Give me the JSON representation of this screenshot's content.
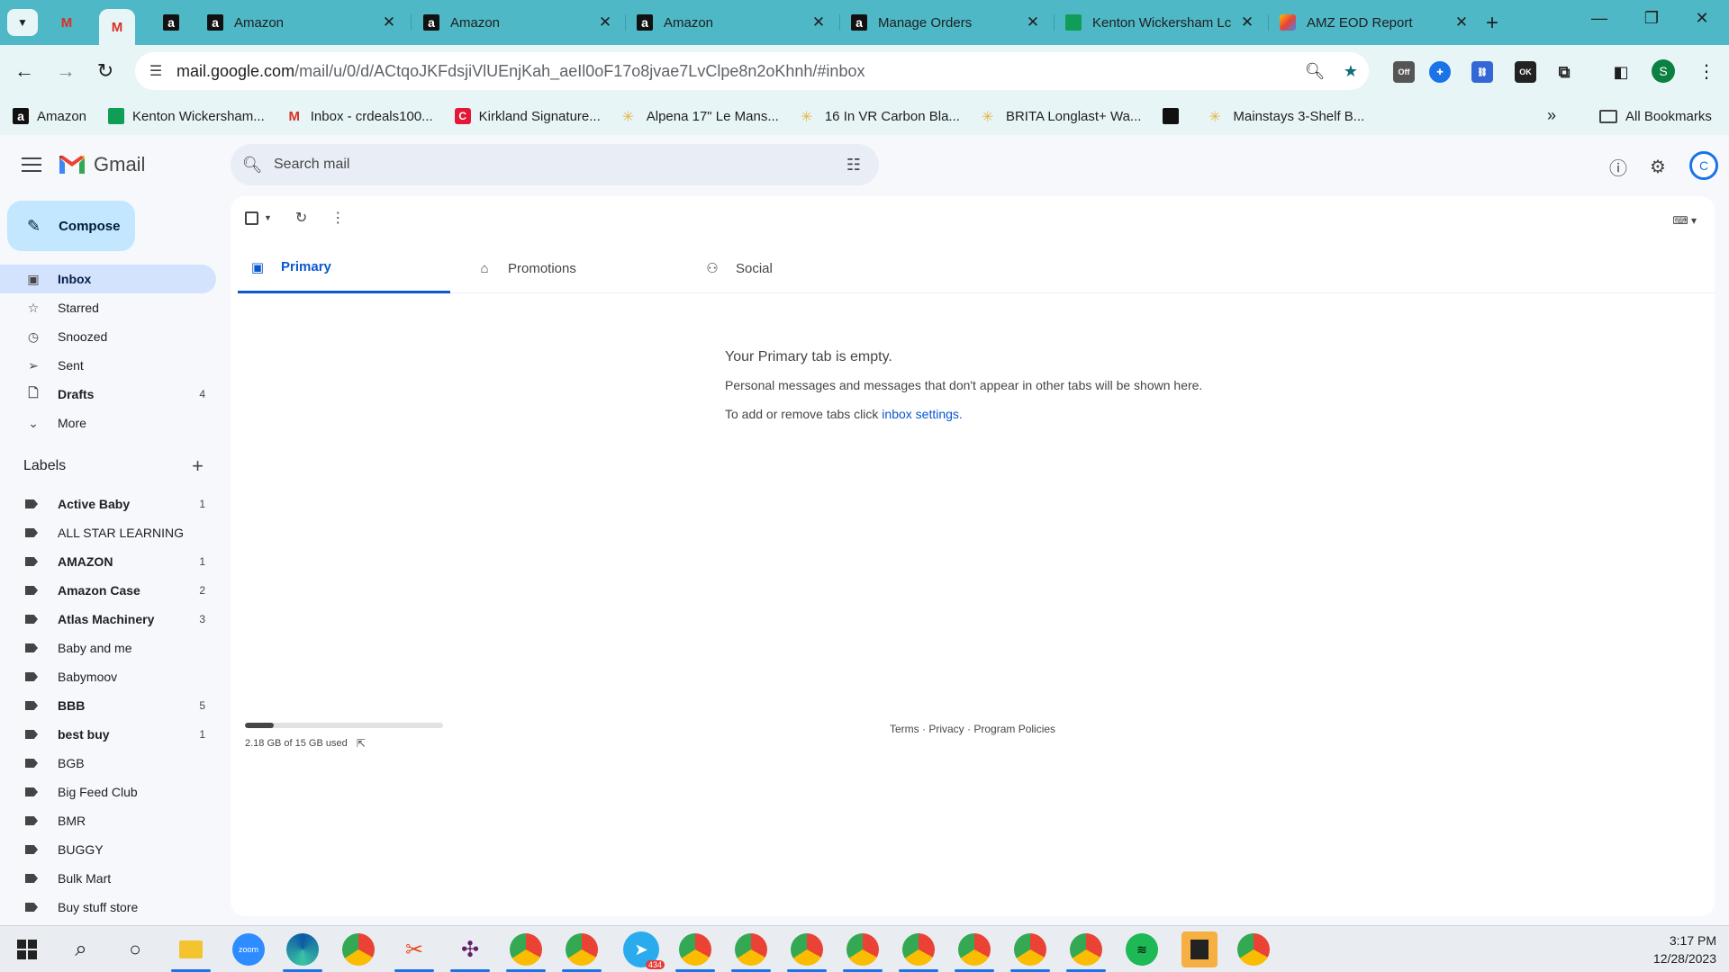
{
  "browser": {
    "tabs": [
      {
        "title": "Amazon"
      },
      {
        "title": "Amazon"
      },
      {
        "title": "Amazon"
      },
      {
        "title": "Manage Orders"
      },
      {
        "title": "Kenton Wickersham Lc"
      },
      {
        "title": "AMZ EOD Report"
      }
    ],
    "url_host": "mail.google.com",
    "url_path": "/mail/u/0/d/ACtqoJKFdsjiVlUEnjKah_aeIl0oF17o8jvae7LvClpe8n2oKhnh/#inbox",
    "profile_initial": "S",
    "ext_off_label": "Off",
    "ext_ok_label": "OK"
  },
  "bookmarks": [
    {
      "label": "Amazon",
      "icon": "amazon"
    },
    {
      "label": "Kenton Wickersham...",
      "icon": "sheets"
    },
    {
      "label": "Inbox - crdeals100...",
      "icon": "gmail"
    },
    {
      "label": "Kirkland Signature...",
      "icon": "costco"
    },
    {
      "label": "Alpena 17\" Le Mans...",
      "icon": "walmart"
    },
    {
      "label": "16 In VR Carbon Bla...",
      "icon": "walmart"
    },
    {
      "label": "BRITA Longlast+ Wa...",
      "icon": "walmart"
    },
    {
      "label": "",
      "icon": "dark"
    },
    {
      "label": "Mainstays 3-Shelf B...",
      "icon": "walmart"
    }
  ],
  "bookmarks_all": "All Bookmarks",
  "gmail": {
    "logo_text": "Gmail",
    "search_placeholder": "Search mail",
    "compose_label": "Compose",
    "avatar_initial": "C",
    "nav": [
      {
        "label": "Inbox",
        "icon": "inbox",
        "count": "",
        "active": true,
        "bold": true
      },
      {
        "label": "Starred",
        "icon": "star",
        "count": "",
        "active": false,
        "bold": false
      },
      {
        "label": "Snoozed",
        "icon": "clock",
        "count": "",
        "active": false,
        "bold": false
      },
      {
        "label": "Sent",
        "icon": "send",
        "count": "",
        "active": false,
        "bold": false
      },
      {
        "label": "Drafts",
        "icon": "draft",
        "count": "4",
        "active": false,
        "bold": true
      },
      {
        "label": "More",
        "icon": "chevron",
        "count": "",
        "active": false,
        "bold": false
      }
    ],
    "labels_title": "Labels",
    "labels": [
      {
        "name": "Active Baby",
        "count": "1",
        "bold": true
      },
      {
        "name": "ALL STAR LEARNING",
        "count": "",
        "bold": false
      },
      {
        "name": "AMAZON",
        "count": "1",
        "bold": true
      },
      {
        "name": "Amazon Case",
        "count": "2",
        "bold": true
      },
      {
        "name": "Atlas Machinery",
        "count": "3",
        "bold": true
      },
      {
        "name": "Baby and me",
        "count": "",
        "bold": false
      },
      {
        "name": "Babymoov",
        "count": "",
        "bold": false
      },
      {
        "name": "BBB",
        "count": "5",
        "bold": true
      },
      {
        "name": "best buy",
        "count": "1",
        "bold": true
      },
      {
        "name": "BGB",
        "count": "",
        "bold": false
      },
      {
        "name": "Big Feed Club",
        "count": "",
        "bold": false
      },
      {
        "name": "BMR",
        "count": "",
        "bold": false
      },
      {
        "name": "BUGGY",
        "count": "",
        "bold": false
      },
      {
        "name": "Bulk Mart",
        "count": "",
        "bold": false
      },
      {
        "name": "Buy stuff store",
        "count": "",
        "bold": false
      }
    ],
    "categories": [
      {
        "label": "Primary",
        "icon": "inbox"
      },
      {
        "label": "Promotions",
        "icon": "tag"
      },
      {
        "label": "Social",
        "icon": "people"
      }
    ],
    "empty": {
      "title": "Your Primary tab is empty.",
      "line1": "Personal messages and messages that don't appear in other tabs will be shown here.",
      "line2_prefix": "To add or remove tabs click ",
      "line2_link": "inbox settings."
    },
    "storage": {
      "text": "2.18 GB of 15 GB used",
      "used_fraction": 0.145
    },
    "footer": {
      "terms": "Terms",
      "sep": " · ",
      "privacy": "Privacy",
      "policies": "Program Policies"
    }
  },
  "taskbar": {
    "time": "3:17 PM",
    "date": "12/28/2023",
    "telegram_badge": "434"
  },
  "colors": {
    "chrome_frame": "#4fb8c6",
    "toolbar": "#e8f5f7",
    "gmail_bg": "#f6f8fc",
    "compose": "#c2e7ff",
    "active_nav": "#d3e3fd",
    "accent_blue": "#0b57d0"
  }
}
